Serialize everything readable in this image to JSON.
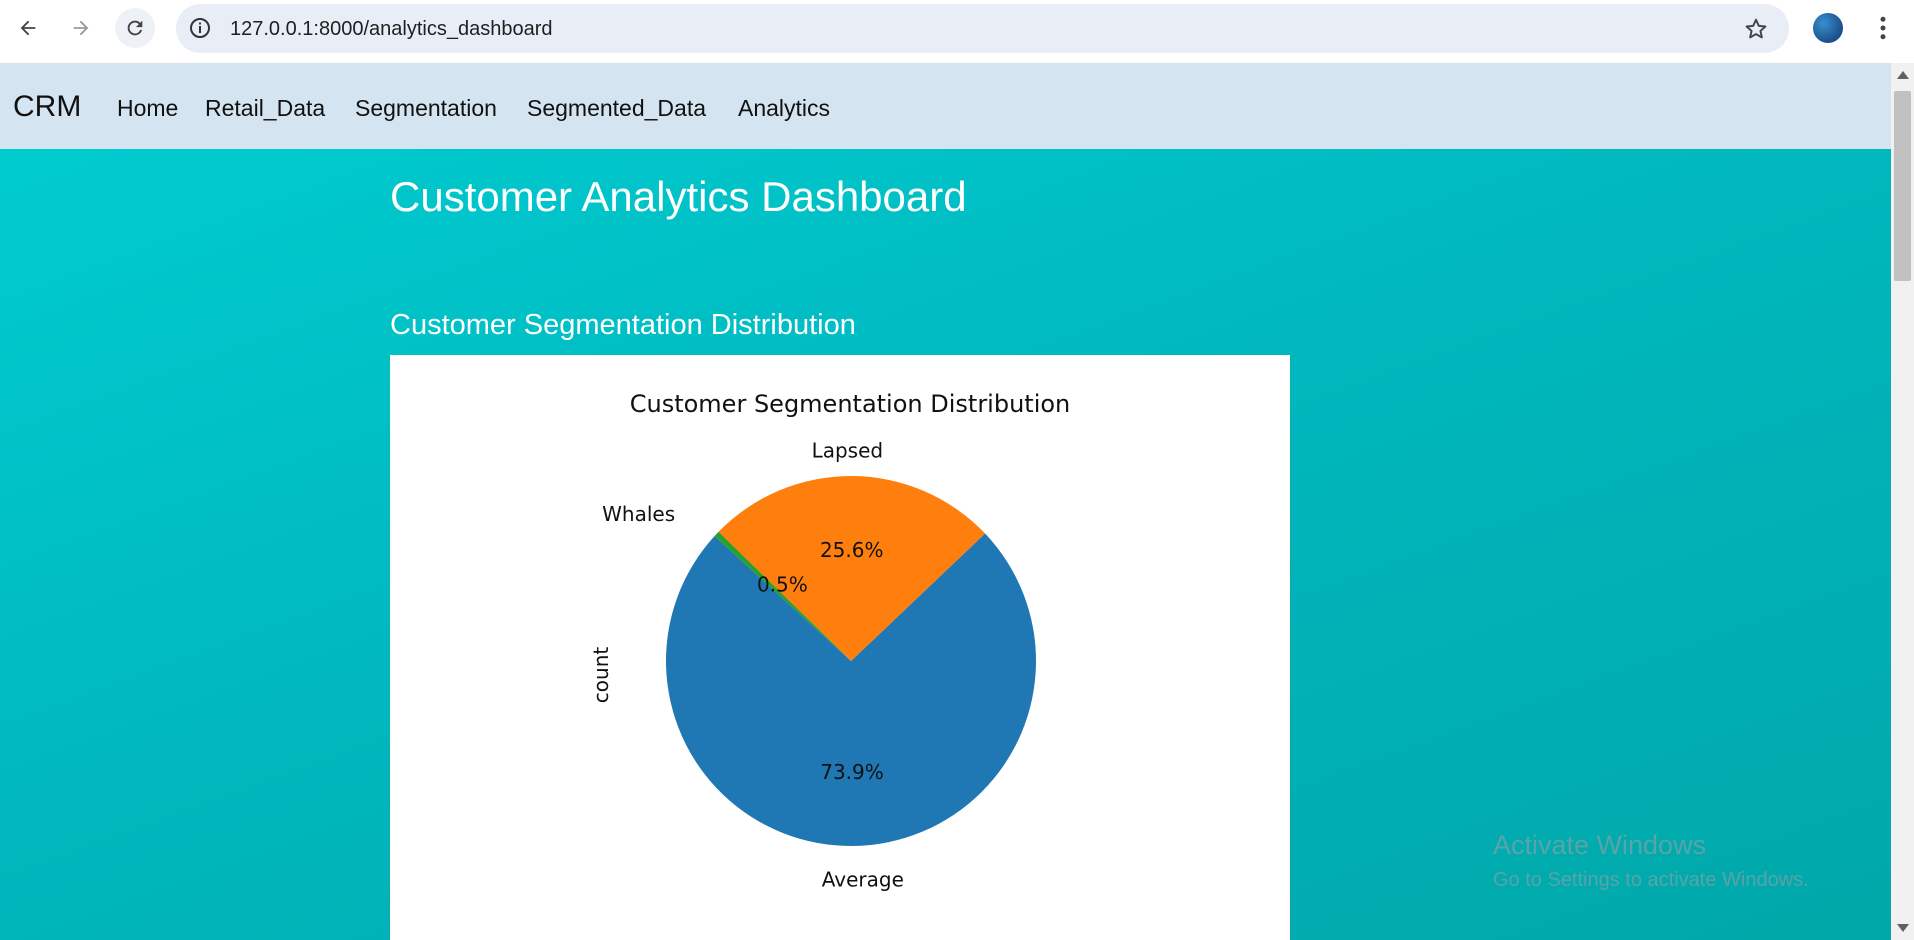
{
  "browser": {
    "url": "127.0.0.1:8000/analytics_dashboard"
  },
  "nav": {
    "brand": "CRM",
    "links": [
      "Home",
      "Retail_Data",
      "Segmentation",
      "Segmented_Data",
      "Analytics"
    ]
  },
  "main": {
    "page_title": "Customer Analytics Dashboard",
    "section_title": "Customer Segmentation Distribution"
  },
  "colors": {
    "nav_bg": "#d4e5f1",
    "main_bg": "#00bfc4",
    "average": "#1f77b4",
    "lapsed": "#ff7f0e",
    "whales": "#2ca02c"
  },
  "chart_data": {
    "type": "pie",
    "title": "Customer Segmentation Distribution",
    "ylabel": "count",
    "slices": [
      {
        "label": "Average",
        "percent": 73.9,
        "pct_label": "73.9%"
      },
      {
        "label": "Lapsed",
        "percent": 25.6,
        "pct_label": "25.6%"
      },
      {
        "label": "Whales",
        "percent": 0.5,
        "pct_label": "0.5%"
      }
    ]
  },
  "watermark": {
    "title": "Activate Windows",
    "subtitle": "Go to Settings to activate Windows."
  }
}
